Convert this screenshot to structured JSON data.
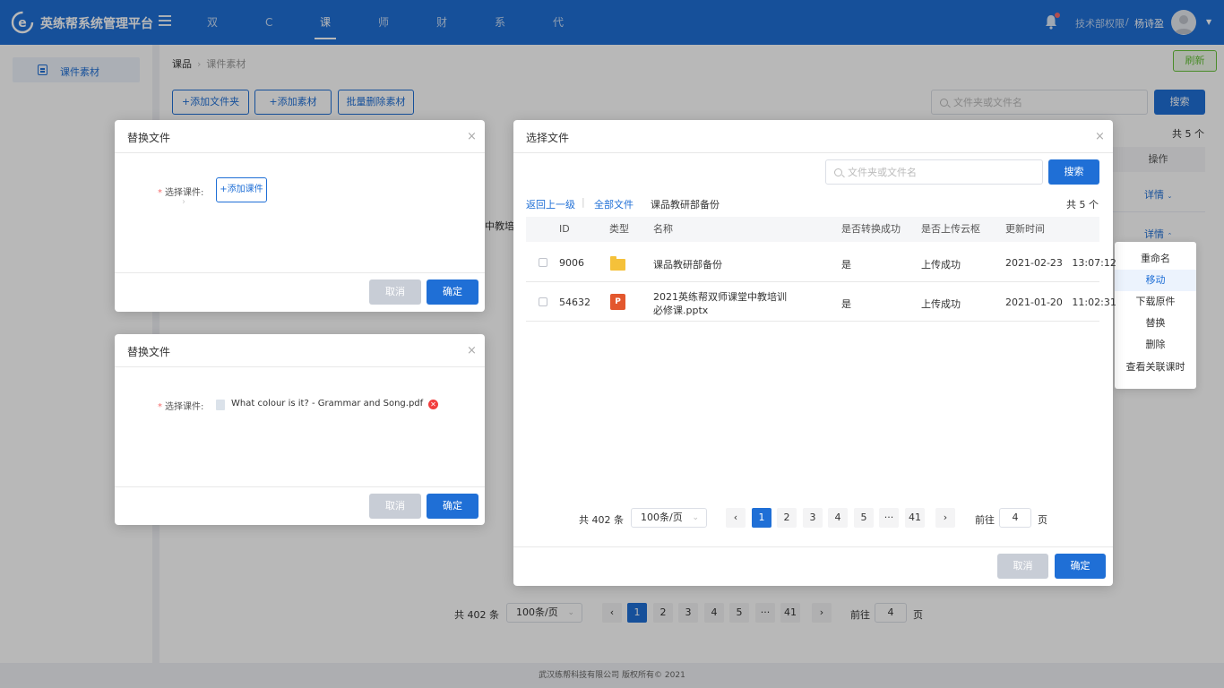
{
  "header": {
    "brand": "英练帮系统管理平台",
    "nav": [
      "双师",
      "C端",
      "课品",
      "师资",
      "财务",
      "系统",
      "代理商"
    ],
    "active_nav": "课品",
    "dept": "技术部权限",
    "separator": "/",
    "user": "杨诗盈"
  },
  "sidebar": {
    "items": [
      {
        "label": "课件素材"
      }
    ]
  },
  "main": {
    "breadcrumb": [
      "课品",
      "课件素材"
    ],
    "refresh": "刷新",
    "toolbar": {
      "add_folder": "+添加文件夹",
      "add_material": "+添加素材",
      "batch_delete": "批量删除素材"
    },
    "search_placeholder": "文件夹或文件名",
    "search_button": "搜索",
    "total": "共 5 个",
    "col_operation": "操作",
    "detail_label": "详情",
    "partial_row_text": "中教培",
    "row_menu": [
      "重命名",
      "移动",
      "下载原件",
      "替换",
      "删除",
      "查看关联课时"
    ],
    "row_menu_hover": "移动",
    "pagination": {
      "total": "共 402 条",
      "page_size": "100条/页",
      "pages": [
        "1",
        "2",
        "3",
        "4",
        "5",
        "···",
        "41"
      ],
      "current": "1",
      "goto_prefix": "前往",
      "goto_value": "4",
      "goto_suffix": "页"
    }
  },
  "replace_dialog_1": {
    "title": "替换文件",
    "label": "选择课件:",
    "add_button": "+添加课件",
    "cancel": "取消",
    "confirm": "确定"
  },
  "replace_dialog_2": {
    "title": "替换文件",
    "label": "选择课件:",
    "file_name": "What colour is it? - Grammar and Song.pdf",
    "cancel": "取消",
    "confirm": "确定"
  },
  "select_dialog": {
    "title": "选择文件",
    "search_placeholder": "文件夹或文件名",
    "search_button": "搜索",
    "back_link": "返回上一级",
    "divider": "|",
    "all_files_link": "全部文件",
    "current_folder": "课品教研部备份",
    "total": "共 5 个",
    "columns": [
      "ID",
      "类型",
      "名称",
      "是否转换成功",
      "是否上传云枢",
      "更新时间"
    ],
    "rows": [
      {
        "id": "9006",
        "type": "folder",
        "name": [
          "课品教研部备份"
        ],
        "converted": "是",
        "uploaded": "上传成功",
        "updated": "2021-02-23   13:07:12"
      },
      {
        "id": "54632",
        "type": "pptx",
        "type_letter": "P",
        "name": [
          "2021英练帮双师课堂中教培训",
          "必修课.pptx"
        ],
        "converted": "是",
        "uploaded": "上传成功",
        "updated": "2021-01-20   11:02:31"
      }
    ],
    "pagination": {
      "total": "共 402 条",
      "page_size": "100条/页",
      "pages": [
        "1",
        "2",
        "3",
        "4",
        "5",
        "···",
        "41"
      ],
      "current": "1",
      "goto_prefix": "前往",
      "goto_value": "4",
      "goto_suffix": "页"
    },
    "cancel": "取消",
    "confirm": "确定"
  },
  "footer": "武汉练帮科技有限公司 版权所有© 2021",
  "colors": {
    "primary": "#1f6fd6",
    "success": "#67c23a",
    "danger": "#f23d3d",
    "disabled": "#c8cdd6"
  }
}
